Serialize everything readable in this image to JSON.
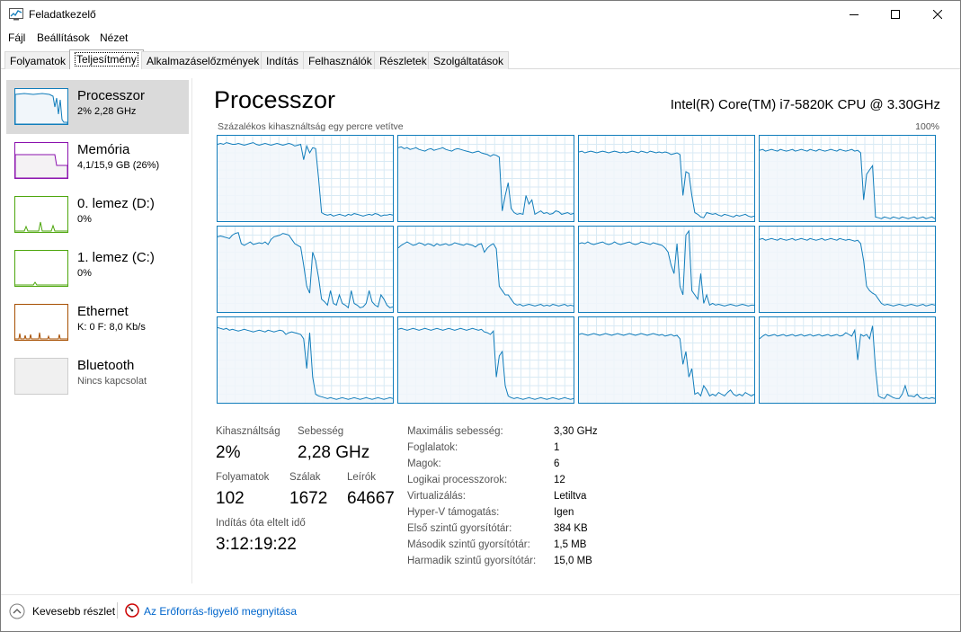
{
  "window": {
    "title": "Feladatkezelő"
  },
  "menu": [
    "Fájl",
    "Beállítások",
    "Nézet"
  ],
  "tabs": [
    "Folyamatok",
    "Teljesítmény",
    "Alkalmazáselőzmények",
    "Indítás",
    "Felhasználók",
    "Részletek",
    "Szolgáltatások"
  ],
  "sidebar": [
    {
      "title": "Processzor",
      "sub": "2% 2,28 GHz"
    },
    {
      "title": "Memória",
      "sub": "4,1/15,9 GB (26%)"
    },
    {
      "title": "0. lemez (D:)",
      "sub": "0%"
    },
    {
      "title": "1. lemez (C:)",
      "sub": "0%"
    },
    {
      "title": "Ethernet",
      "sub": "K: 0 F: 8,0 Kb/s"
    },
    {
      "title": "Bluetooth",
      "sub": "Nincs kapcsolat"
    }
  ],
  "main": {
    "title": "Processzor",
    "cpu_name": "Intel(R) Core(TM) i7-5820K CPU @ 3.30GHz",
    "graph_caption": "Százalékos kihasználtság egy percre vetítve",
    "graph_max": "100%"
  },
  "stats": {
    "utilization_label": "Kihasználtság",
    "utilization": "2%",
    "speed_label": "Sebesség",
    "speed": "2,28 GHz",
    "processes_label": "Folyamatok",
    "processes": "102",
    "threads_label": "Szálak",
    "threads": "1672",
    "handles_label": "Leírók",
    "handles": "64667",
    "uptime_label": "Indítás óta eltelt idő",
    "uptime": "3:12:19:22"
  },
  "details": [
    {
      "label": "Maximális sebesség:",
      "value": "3,30 GHz"
    },
    {
      "label": "Foglalatok:",
      "value": "1"
    },
    {
      "label": "Magok:",
      "value": "6"
    },
    {
      "label": "Logikai processzorok:",
      "value": "12"
    },
    {
      "label": "Virtualizálás:",
      "value": "Letiltva"
    },
    {
      "label": "Hyper-V támogatás:",
      "value": "Igen"
    },
    {
      "label": "Első szintű gyorsítótár:",
      "value": "384 KB"
    },
    {
      "label": "Második szintű gyorsítótár:",
      "value": "1,5 MB"
    },
    {
      "label": "Harmadik szintű gyorsítótár:",
      "value": "15,0 MB"
    }
  ],
  "footer": {
    "fewer_details": "Kevesebb részlet",
    "resource_monitor": "Az Erőforrás-figyelő megnyitása"
  },
  "colors": {
    "cpu": "#117dbb",
    "memory": "#8b12ae",
    "disk": "#4da60c",
    "ethernet": "#a74f01",
    "bluetooth": "#cccccc"
  },
  "chart_data": {
    "type": "line",
    "x": [
      0,
      1,
      2,
      3,
      4,
      5,
      6,
      7,
      8,
      9,
      10,
      11,
      12,
      13,
      14,
      15,
      16,
      17,
      18,
      19,
      20,
      21,
      22,
      23,
      24,
      25,
      26,
      27,
      28,
      29,
      30,
      31,
      32,
      33,
      34,
      35,
      36,
      37,
      38,
      39,
      40,
      41,
      42,
      43,
      44,
      45,
      46,
      47,
      48,
      49,
      50,
      51,
      52,
      53,
      54,
      55,
      56,
      57,
      58,
      59
    ],
    "ylim": [
      0,
      100
    ],
    "series": [
      {
        "values": [
          90,
          91,
          90,
          92,
          91,
          90,
          90,
          91,
          90,
          89,
          90,
          91,
          92,
          90,
          89,
          90,
          91,
          90,
          89,
          90,
          91,
          90,
          89,
          90,
          91,
          90,
          88,
          89,
          90,
          72,
          88,
          80,
          86,
          85,
          50,
          10,
          8,
          7,
          8,
          6,
          7,
          8,
          7,
          6,
          8,
          7,
          9,
          8,
          7,
          6,
          7,
          8,
          7,
          9,
          8,
          6,
          7,
          7,
          8,
          7
        ]
      },
      {
        "values": [
          86,
          87,
          85,
          86,
          84,
          85,
          86,
          84,
          83,
          82,
          84,
          85,
          83,
          84,
          85,
          86,
          84,
          83,
          82,
          84,
          85,
          84,
          83,
          82,
          81,
          80,
          81,
          82,
          80,
          79,
          78,
          76,
          78,
          77,
          75,
          12,
          30,
          45,
          15,
          10,
          8,
          9,
          8,
          30,
          20,
          25,
          8,
          10,
          12,
          9,
          10,
          8,
          9,
          12,
          11,
          8,
          9,
          10,
          8,
          9
        ]
      },
      {
        "values": [
          81,
          82,
          80,
          81,
          82,
          81,
          80,
          81,
          82,
          81,
          80,
          81,
          82,
          81,
          80,
          81,
          80,
          81,
          82,
          81,
          80,
          82,
          81,
          80,
          82,
          81,
          80,
          81,
          80,
          81,
          80,
          78,
          79,
          80,
          78,
          30,
          58,
          56,
          30,
          10,
          8,
          5,
          4,
          10,
          9,
          8,
          9,
          7,
          6,
          8,
          7,
          6,
          5,
          7,
          6,
          7,
          8,
          6,
          5,
          6
        ]
      },
      {
        "values": [
          83,
          84,
          82,
          83,
          84,
          83,
          82,
          84,
          83,
          82,
          83,
          84,
          82,
          83,
          84,
          83,
          82,
          84,
          83,
          82,
          84,
          83,
          82,
          83,
          84,
          83,
          82,
          84,
          83,
          82,
          83,
          84,
          82,
          83,
          80,
          25,
          55,
          60,
          65,
          5,
          4,
          3,
          5,
          4,
          3,
          5,
          4,
          3,
          5,
          4,
          3,
          4,
          5,
          3,
          4,
          5,
          3,
          4,
          5,
          3
        ]
      },
      {
        "values": [
          88,
          89,
          88,
          87,
          86,
          90,
          92,
          93,
          80,
          78,
          80,
          82,
          79,
          80,
          81,
          80,
          82,
          79,
          85,
          88,
          89,
          90,
          92,
          91,
          90,
          85,
          80,
          78,
          76,
          55,
          30,
          22,
          70,
          60,
          40,
          15,
          12,
          8,
          25,
          10,
          8,
          20,
          10,
          8,
          5,
          25,
          10,
          8,
          5,
          6,
          10,
          25,
          12,
          8,
          6,
          20,
          15,
          8,
          5,
          6
        ]
      },
      {
        "values": [
          75,
          78,
          80,
          82,
          80,
          78,
          79,
          81,
          80,
          78,
          80,
          79,
          77,
          80,
          78,
          79,
          80,
          78,
          79,
          81,
          80,
          79,
          78,
          80,
          79,
          78,
          76,
          79,
          80,
          70,
          75,
          78,
          80,
          74,
          30,
          25,
          20,
          20,
          15,
          10,
          8,
          9,
          7,
          8,
          9,
          8,
          7,
          8,
          9,
          7,
          8,
          7,
          9,
          8,
          7,
          8,
          9,
          7,
          8,
          7
        ]
      },
      {
        "values": [
          80,
          81,
          80,
          82,
          80,
          79,
          80,
          81,
          82,
          80,
          79,
          80,
          82,
          80,
          79,
          80,
          81,
          82,
          80,
          79,
          80,
          82,
          81,
          80,
          79,
          81,
          80,
          79,
          78,
          75,
          70,
          55,
          45,
          80,
          30,
          20,
          90,
          95,
          25,
          20,
          15,
          45,
          10,
          20,
          8,
          10,
          8,
          9,
          8,
          7,
          8,
          9,
          8,
          7,
          8,
          9,
          8,
          7,
          8,
          8
        ]
      },
      {
        "values": [
          85,
          86,
          84,
          85,
          86,
          85,
          84,
          86,
          85,
          84,
          85,
          86,
          84,
          85,
          86,
          85,
          84,
          86,
          85,
          84,
          85,
          86,
          84,
          85,
          86,
          85,
          84,
          86,
          85,
          84,
          85,
          84,
          83,
          84,
          80,
          60,
          30,
          25,
          22,
          20,
          15,
          10,
          8,
          9,
          8,
          7,
          8,
          9,
          8,
          7,
          8,
          9,
          8,
          7,
          8,
          9,
          7,
          8,
          9,
          8
        ]
      },
      {
        "values": [
          88,
          87,
          86,
          87,
          85,
          86,
          85,
          84,
          85,
          86,
          85,
          84,
          83,
          84,
          85,
          84,
          83,
          85,
          84,
          83,
          84,
          85,
          84,
          80,
          82,
          83,
          82,
          81,
          80,
          75,
          40,
          82,
          30,
          10,
          8,
          7,
          6,
          5,
          6,
          5,
          4,
          5,
          6,
          5,
          4,
          5,
          6,
          5,
          4,
          5,
          6,
          5,
          4,
          5,
          6,
          5,
          4,
          5,
          6,
          5
        ]
      },
      {
        "values": [
          86,
          87,
          86,
          85,
          86,
          87,
          86,
          85,
          86,
          87,
          86,
          85,
          86,
          87,
          86,
          85,
          86,
          87,
          86,
          85,
          86,
          87,
          86,
          85,
          86,
          87,
          86,
          85,
          86,
          83,
          82,
          80,
          84,
          30,
          55,
          60,
          20,
          8,
          6,
          5,
          6,
          5,
          4,
          5,
          6,
          5,
          4,
          5,
          6,
          5,
          4,
          5,
          6,
          5,
          4,
          5,
          6,
          5,
          4,
          5
        ]
      },
      {
        "values": [
          80,
          81,
          80,
          79,
          80,
          81,
          80,
          79,
          80,
          81,
          80,
          79,
          80,
          81,
          80,
          79,
          80,
          81,
          80,
          79,
          80,
          81,
          80,
          79,
          80,
          81,
          80,
          79,
          80,
          78,
          79,
          80,
          78,
          79,
          75,
          45,
          60,
          30,
          40,
          10,
          12,
          8,
          20,
          15,
          8,
          10,
          8,
          12,
          10,
          8,
          12,
          15,
          10,
          8,
          10,
          8,
          12,
          10,
          8,
          10
        ]
      },
      {
        "values": [
          75,
          78,
          80,
          78,
          79,
          80,
          78,
          79,
          80,
          78,
          79,
          80,
          78,
          79,
          80,
          78,
          79,
          80,
          78,
          79,
          80,
          78,
          79,
          80,
          78,
          79,
          80,
          78,
          79,
          82,
          80,
          78,
          85,
          50,
          80,
          78,
          80,
          75,
          90,
          40,
          8,
          6,
          5,
          10,
          8,
          6,
          5,
          5,
          10,
          20,
          8,
          8,
          7,
          10,
          6,
          5,
          6,
          5,
          6,
          5
        ]
      }
    ]
  }
}
